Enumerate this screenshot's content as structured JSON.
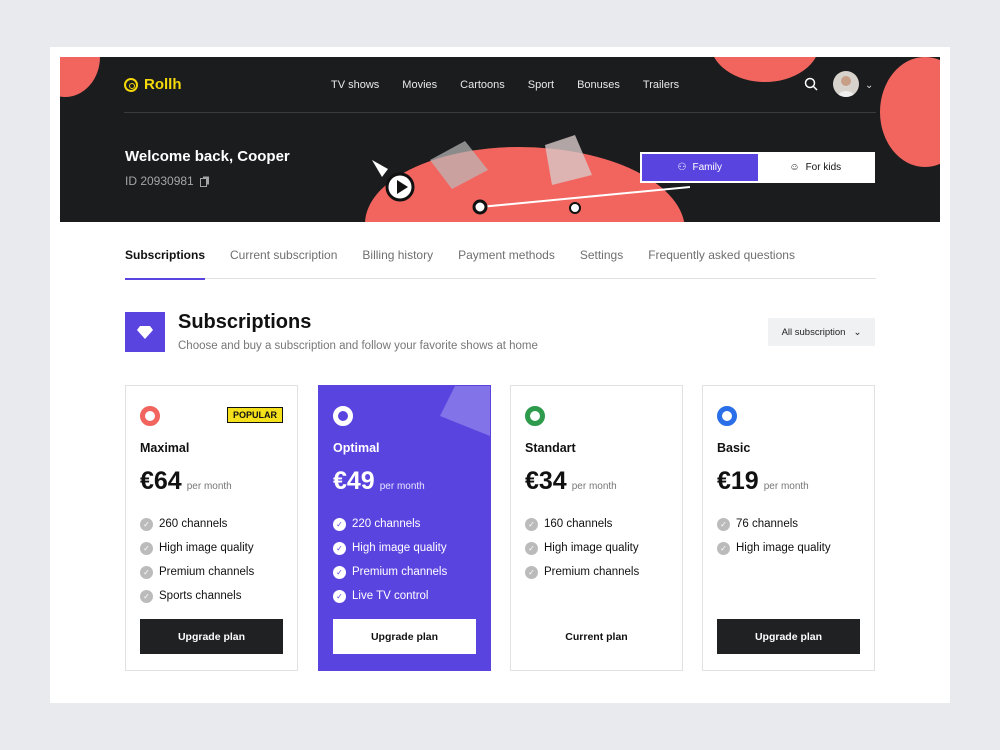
{
  "app": {
    "logo": "Rollh"
  },
  "nav": {
    "items": [
      "TV shows",
      "Movies",
      "Cartoons",
      "Sport",
      "Bonuses",
      "Trailers"
    ]
  },
  "user": {
    "welcome": "Welcome back, Cooper",
    "id": "ID 20930981"
  },
  "profile_toggle": {
    "options": [
      "Family",
      "For kids"
    ],
    "selected": "Family"
  },
  "tabs": [
    "Subscriptions",
    "Current subscription",
    "Billing history",
    "Payment methods",
    "Settings",
    "Frequently asked questions"
  ],
  "section": {
    "title": "Subscriptions",
    "subtitle": "Choose and buy a subscription and follow your favorite shows at home",
    "filter": "All subscription"
  },
  "plans": [
    {
      "name": "Maximal",
      "price": "€64",
      "period": "per month",
      "badge": "POPULAR",
      "color": "#f2655f",
      "features": [
        "260 channels",
        "High image quality",
        "Premium channels",
        "Sports channels"
      ],
      "button": "Upgrade plan"
    },
    {
      "name": "Optimal",
      "price": "€49",
      "period": "per month",
      "color": "#ffffff",
      "features": [
        "220 channels",
        "High image quality",
        "Premium channels",
        "Live TV control"
      ],
      "button": "Upgrade plan"
    },
    {
      "name": "Standart",
      "price": "€34",
      "period": "per month",
      "color": "#2e9a4c",
      "features": [
        "160 channels",
        "High image quality",
        "Premium channels"
      ],
      "button": "Current plan"
    },
    {
      "name": "Basic",
      "price": "€19",
      "period": "per month",
      "color": "#2a6ee8",
      "features": [
        "76 channels",
        "High image quality"
      ],
      "button": "Upgrade plan"
    }
  ],
  "colors": {
    "accent": "#5a44e0",
    "coral": "#f2655f",
    "brand_yellow": "#f5d90a"
  }
}
